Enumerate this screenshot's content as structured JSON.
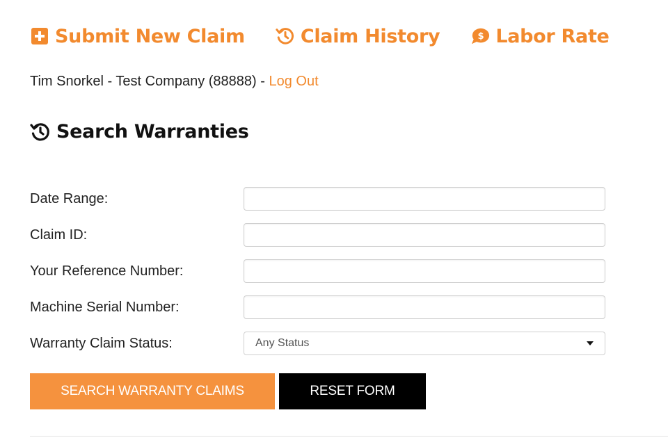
{
  "nav": {
    "submit_label": "Submit New Claim",
    "history_label": "Claim History",
    "labor_label": "Labor Rate"
  },
  "user": {
    "info": "Tim Snorkel - Test Company (88888) - ",
    "logout_label": "Log Out"
  },
  "search": {
    "heading": "Search Warranties"
  },
  "form": {
    "date_range_label": "Date Range:",
    "date_range_value": "",
    "claim_id_label": "Claim ID:",
    "claim_id_value": "",
    "reference_label": "Your Reference Number:",
    "reference_value": "",
    "serial_label": "Machine Serial Number:",
    "serial_value": "",
    "status_label": "Warranty Claim Status:",
    "status_selected": "Any Status"
  },
  "buttons": {
    "search_label": "Search Warranty Claims",
    "reset_label": "Reset Form"
  },
  "colors": {
    "accent": "#f28a2e",
    "button_orange": "#f5923e",
    "button_dark": "#000000"
  },
  "icons": {
    "submit": "plus-square-icon",
    "history": "history-clock-icon",
    "labor": "dollar-speech-bubble-icon",
    "heading": "history-clock-icon",
    "select": "caret-down-icon"
  }
}
